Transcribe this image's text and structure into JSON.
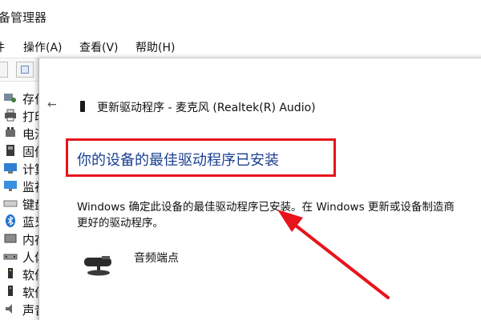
{
  "window": {
    "title": "备管理器"
  },
  "menu": {
    "file": "件",
    "action": "操作(A)",
    "view": "查看(V)",
    "help": "帮助(H)"
  },
  "tree": {
    "items": [
      {
        "label": "存付",
        "icon": "storage-controller-icon"
      },
      {
        "label": "打印",
        "icon": "printer-icon"
      },
      {
        "label": "电池",
        "icon": "battery-icon"
      },
      {
        "label": "固件",
        "icon": "firmware-icon"
      },
      {
        "label": "计算",
        "icon": "computer-icon"
      },
      {
        "label": "监视",
        "icon": "monitor-icon"
      },
      {
        "label": "键盘",
        "icon": "keyboard-icon"
      },
      {
        "label": "蓝牙",
        "icon": "bluetooth-icon"
      },
      {
        "label": "内存",
        "icon": "memory-icon"
      },
      {
        "label": "人体",
        "icon": "hid-icon"
      },
      {
        "label": "软件",
        "icon": "software-component-icon"
      },
      {
        "label": "软件",
        "icon": "software-device-icon"
      },
      {
        "label": "声音",
        "icon": "sound-icon"
      }
    ]
  },
  "dialog": {
    "back_label": "←",
    "title": "更新驱动程序 - 麦克风 (Realtek(R) Audio)",
    "heading": "你的设备的最佳驱动程序已安装",
    "body_line1": "Windows 确定此设备的最佳驱动程序已安装。在 Windows 更新或设备制造商",
    "body_line2": "更好的驱动程序。",
    "device_name": "音频端点",
    "device_icon": "webcam-icon"
  },
  "colors": {
    "heading": "#1a3f91",
    "annotation": "#e8141c"
  }
}
